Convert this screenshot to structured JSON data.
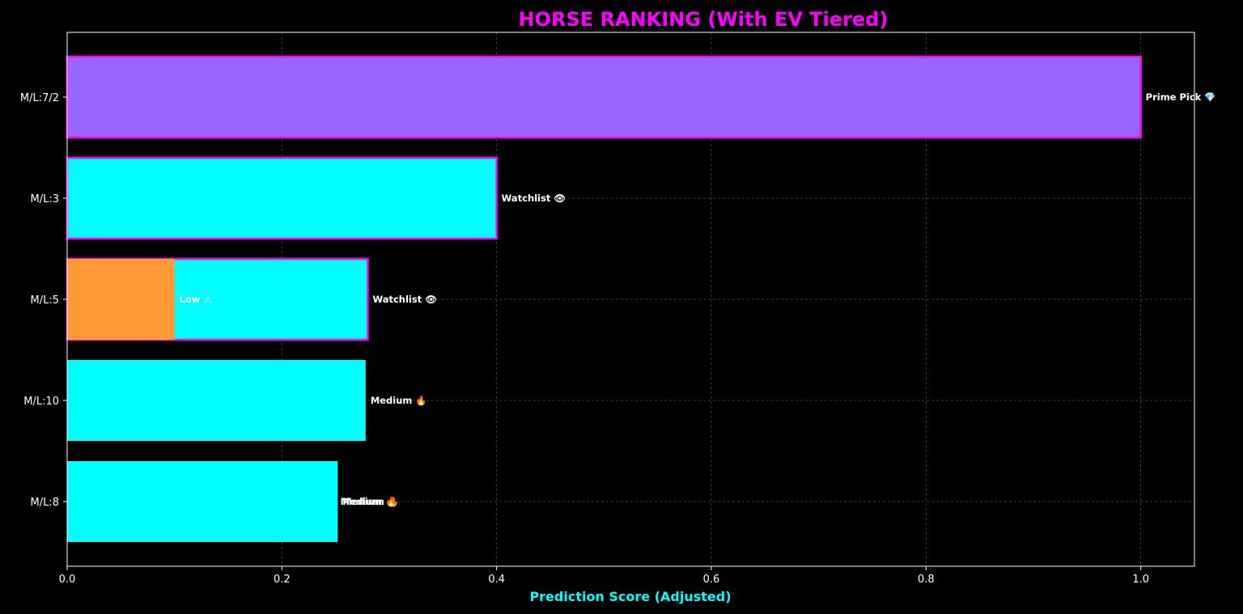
{
  "chart_data": {
    "type": "bar",
    "orientation": "horizontal",
    "title": "HORSE RANKING (With EV Tiered)",
    "xlabel": "Prediction Score (Adjusted)",
    "ylabel": "",
    "xlim": [
      0,
      1.05
    ],
    "x_ticks": [
      "0.0",
      "0.2",
      "0.4",
      "0.6",
      "0.8",
      "1.0"
    ],
    "x_tick_values": [
      0,
      0.2,
      0.4,
      0.6,
      0.8,
      1.0
    ],
    "grid": true,
    "colors": {
      "background": "#000000",
      "title": "#ff00ff",
      "xlabel": "#00ffff",
      "text": "#ffffff",
      "grid": "#1f5f5f",
      "highlight_edge": "#ff00ff"
    },
    "categories": [
      "M/L:7/2",
      "M/L:3",
      "M/L:5",
      "M/L:10",
      "M/L:8"
    ],
    "bars": [
      {
        "category": "M/L:7/2",
        "value": 1.0,
        "color": "#9966ff",
        "highlight": true,
        "label": "Prime Pick 💎"
      },
      {
        "category": "M/L:3",
        "value": 0.4,
        "color": "#00ffff",
        "highlight": true,
        "label": "Watchlist 👁"
      },
      {
        "category": "M/L:5",
        "value": 0.28,
        "color": "#00ffff",
        "highlight": true,
        "label": "Watchlist 👁"
      },
      {
        "category": "M/L:5",
        "value": 0.1,
        "color": "#ff9933",
        "highlight": false,
        "label": "Low ⚠"
      },
      {
        "category": "M/L:10",
        "value": 0.278,
        "color": "#00ffff",
        "highlight": false,
        "label": "Medium 🔥"
      },
      {
        "category": "M/L:8",
        "value": 0.252,
        "color": "#00ffff",
        "highlight": false,
        "label": "Medium 🔥"
      },
      {
        "category": "M/L:8",
        "value": 0.25,
        "color": "#00ffff",
        "highlight": false,
        "label": "Medium 🔥"
      }
    ]
  }
}
